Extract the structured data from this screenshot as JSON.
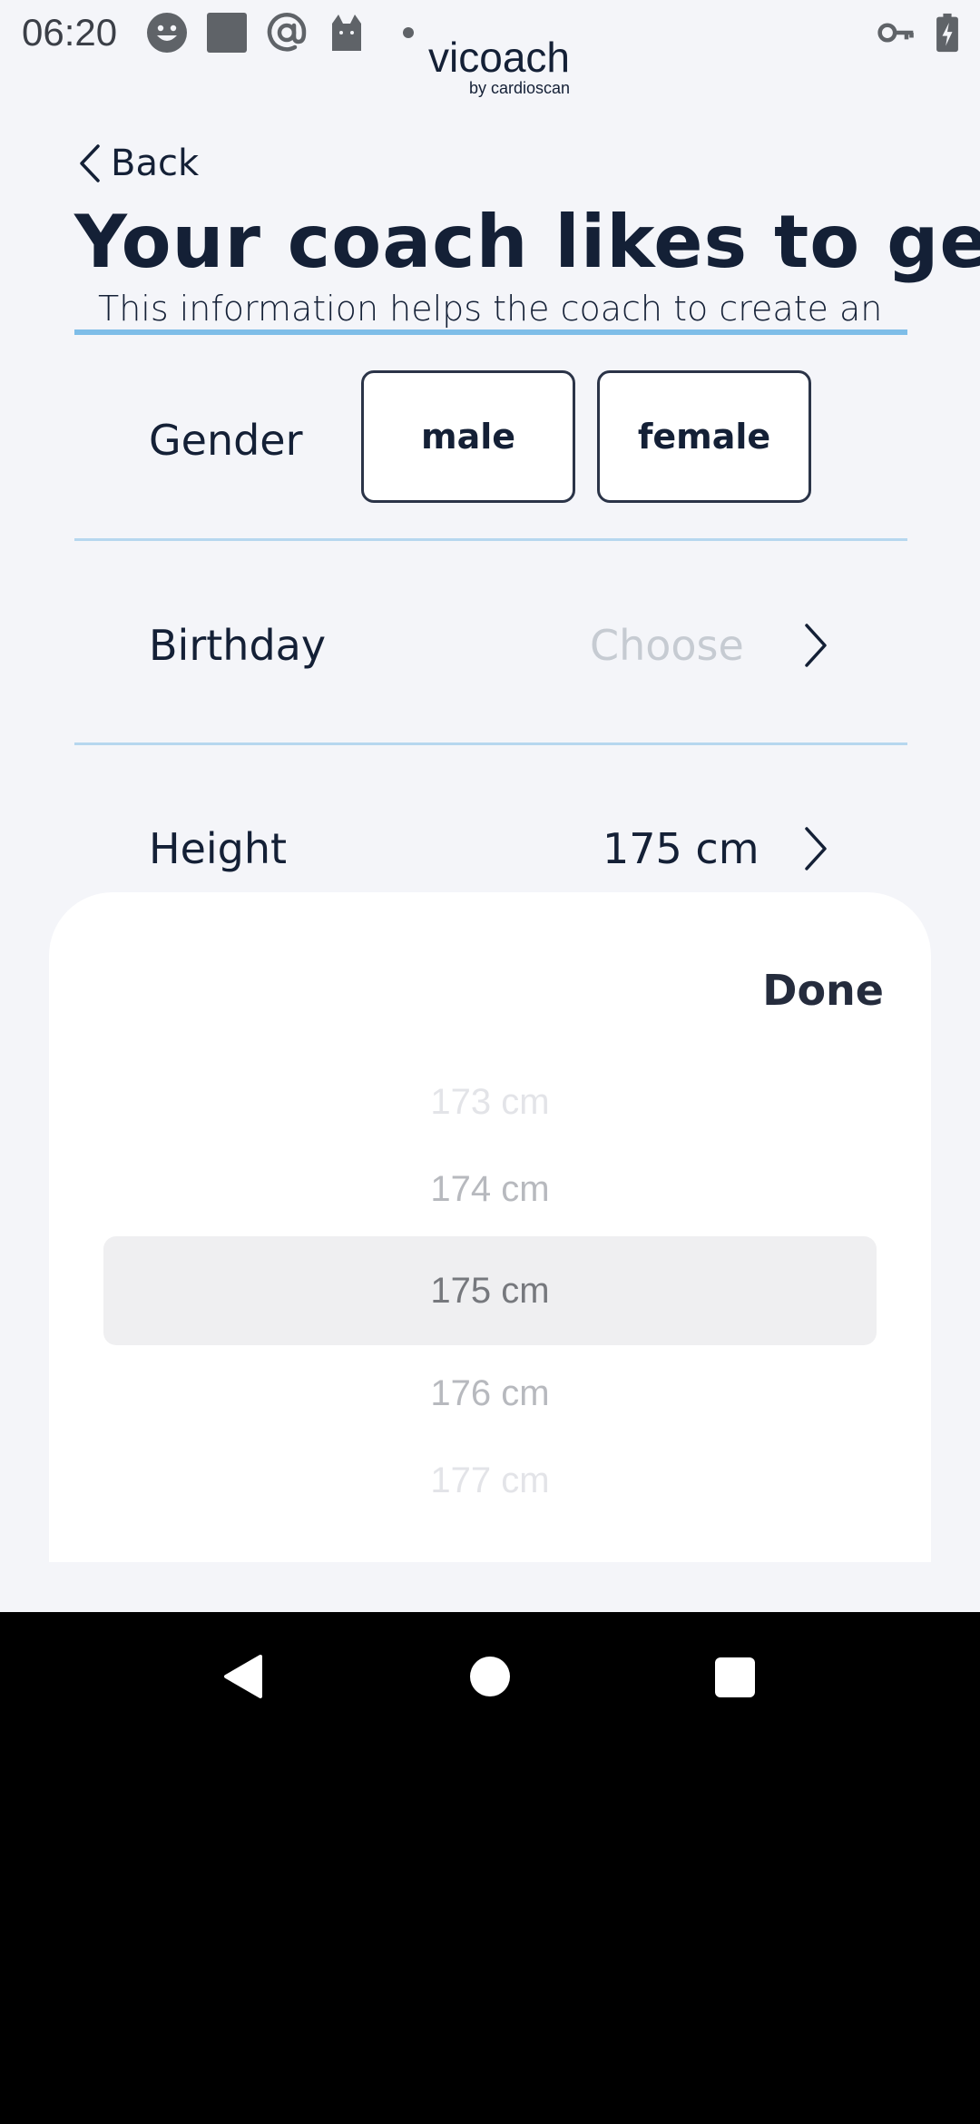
{
  "status_bar": {
    "time": "06:20",
    "icons": [
      "smiley-face-icon",
      "gallery-square-icon",
      "at-sign-icon",
      "cat-icon",
      "notification-dot-icon",
      "key-icon",
      "battery-charging-icon"
    ]
  },
  "brand": {
    "name": "vicoach",
    "sub": "by cardioscan"
  },
  "header": {
    "back_label": "Back",
    "title": "Your coach likes to get",
    "subtitle": "This information helps the coach to create an"
  },
  "form": {
    "gender": {
      "label": "Gender",
      "options": [
        "male",
        "female"
      ]
    },
    "birthday": {
      "label": "Birthday",
      "placeholder": "Choose"
    },
    "height": {
      "label": "Height",
      "value": "175 cm"
    }
  },
  "picker": {
    "done_label": "Done",
    "items": [
      "173 cm",
      "174 cm",
      "175 cm",
      "176 cm",
      "177 cm"
    ],
    "selected": "175 cm"
  },
  "colors": {
    "background": "#f4f5f9",
    "text": "#142036",
    "accent_line": "#7ebde8",
    "divider": "#b6d7ef",
    "placeholder": "#c6cbd2",
    "selected_row": "#efeff1"
  },
  "nav_bar": {
    "icons": [
      "back-triangle-icon",
      "home-circle-icon",
      "recents-square-icon"
    ]
  }
}
